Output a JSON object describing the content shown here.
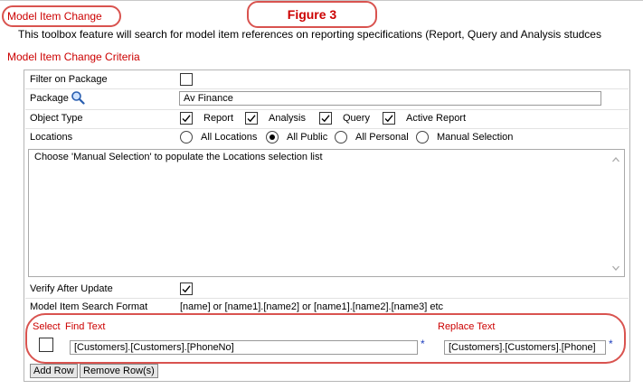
{
  "header": {
    "title": "Model Item Change",
    "figure_label": "Figure 3",
    "description": "This toolbox feature will search for model item references on reporting specifications (Report, Query and Analysis studces"
  },
  "criteria": {
    "title": "Model Item Change Criteria",
    "filter_on_package": {
      "label": "Filter on Package",
      "checked": false
    },
    "package": {
      "label": "Package",
      "value": "Av Finance"
    },
    "object_type": {
      "label": "Object Type",
      "options": [
        {
          "label": "Report",
          "checked": true
        },
        {
          "label": "Analysis",
          "checked": true
        },
        {
          "label": "Query",
          "checked": true
        },
        {
          "label": "Active Report",
          "checked": true
        }
      ]
    },
    "locations": {
      "label": "Locations",
      "options": [
        {
          "label": "All Locations",
          "selected": false
        },
        {
          "label": "All Public",
          "selected": true
        },
        {
          "label": "All Personal",
          "selected": false
        },
        {
          "label": "Manual Selection",
          "selected": false
        }
      ],
      "list_hint": "Choose 'Manual Selection' to populate the Locations selection list"
    },
    "verify_after_update": {
      "label": "Verify After Update",
      "checked": true
    },
    "search_format": {
      "label": "Model Item Search Format",
      "value": "[name] or [name1].[name2] or [name1].[name2].[name3] etc"
    }
  },
  "find_replace": {
    "select_header": "Select",
    "find_header": "Find Text",
    "replace_header": "Replace Text",
    "row": {
      "selected": false,
      "find_value": "[Customers].[Customers].[PhoneNo]",
      "replace_value": "[Customers].[Customers].[Phone]",
      "required_marker": "*"
    }
  },
  "buttons": {
    "add_row": "Add Row",
    "remove_rows": "Remove Row(s)"
  },
  "colors": {
    "accent_red": "#cc0000",
    "annotation": "#d9534f",
    "required": "#1f3fbf"
  }
}
